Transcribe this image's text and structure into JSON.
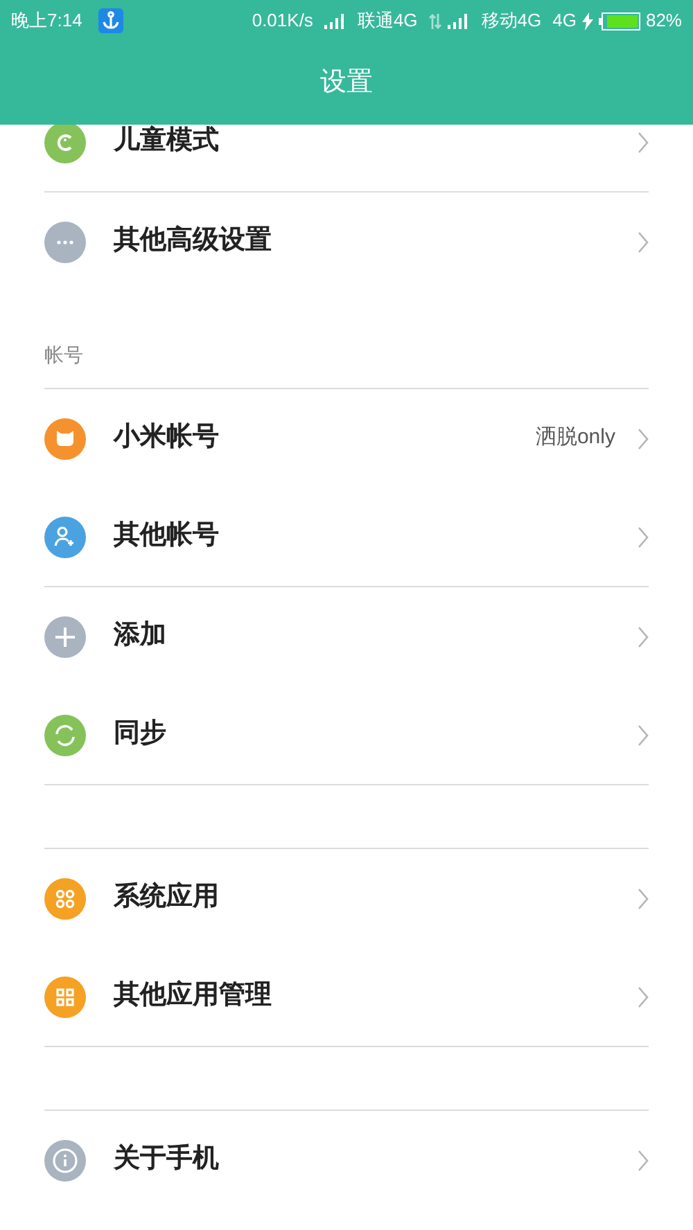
{
  "status_bar": {
    "time": "晚上7:14",
    "speed": "0.01K/s",
    "carrier_1": "联通4G",
    "carrier_2": "移动4G",
    "network": "4G",
    "battery": "82%"
  },
  "title": "设置",
  "list": [
    {
      "kind": "row",
      "color": "#86c25a",
      "label": "儿童模式"
    },
    {
      "kind": "divider"
    },
    {
      "kind": "row",
      "color": "#a9b4c0",
      "label": "其他高级设置"
    },
    {
      "kind": "header",
      "text": "帐号"
    },
    {
      "kind": "divider"
    },
    {
      "kind": "row",
      "color": "#f5922e",
      "label": "小米帐号",
      "value": "洒脱only"
    },
    {
      "kind": "row",
      "color": "#4aa3e0",
      "label": "其他帐号"
    },
    {
      "kind": "divider"
    },
    {
      "kind": "row",
      "color": "#a9b4c0",
      "label": "添加"
    },
    {
      "kind": "row",
      "color": "#86c25a",
      "label": "同步"
    },
    {
      "kind": "divider"
    },
    {
      "kind": "gap"
    },
    {
      "kind": "divider"
    },
    {
      "kind": "row",
      "color": "#f5a124",
      "label": "系统应用"
    },
    {
      "kind": "row",
      "color": "#f5a124",
      "label": "其他应用管理"
    },
    {
      "kind": "divider"
    },
    {
      "kind": "gap"
    },
    {
      "kind": "divider"
    },
    {
      "kind": "row",
      "color": "#a9b4c0",
      "label": "关于手机"
    }
  ]
}
